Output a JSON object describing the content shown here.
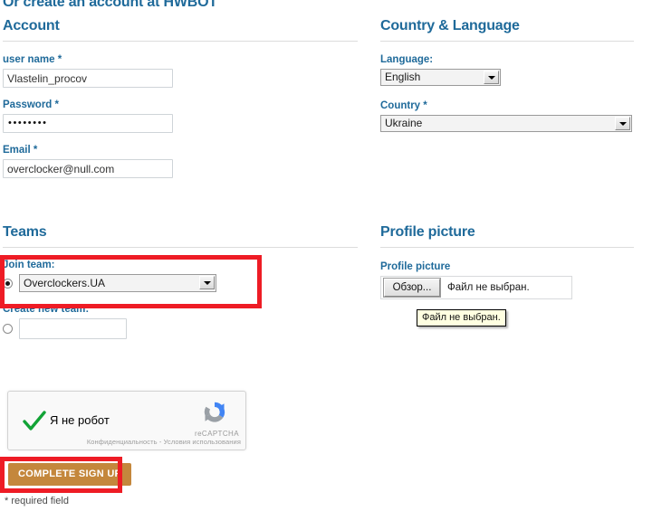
{
  "page": {
    "title": "Or create an account at HWBOT",
    "required_note": "* required field"
  },
  "account": {
    "heading": "Account",
    "username": {
      "label": "user name *",
      "value": "Vlastelin_procov"
    },
    "password": {
      "label": "Password *",
      "value": "••••••••"
    },
    "email": {
      "label": "Email *",
      "value": "overclocker@null.com"
    }
  },
  "country_language": {
    "heading": "Country & Language",
    "language": {
      "label": "Language:",
      "value": "English"
    },
    "country": {
      "label": "Country *",
      "value": "Ukraine"
    }
  },
  "teams": {
    "heading": "Teams",
    "join_team": {
      "label": "Join team:",
      "value": "Overclockers.UA"
    },
    "create_team": {
      "label": "Create new team:",
      "value": ""
    }
  },
  "profile_picture": {
    "heading": "Profile picture",
    "label": "Profile picture",
    "browse_button": "Обзор...",
    "file_status": "Файл не выбран.",
    "tooltip": "Файл не выбран."
  },
  "recaptcha": {
    "label": "Я не робот",
    "brand": "reCAPTCHA",
    "fine_print": "Конфиденциальность - Условия использования"
  },
  "submit": {
    "label": "COMPLETE SIGN UP"
  },
  "colors": {
    "heading_blue": "#1f6a9a",
    "label_blue": "#1f6a9a",
    "button_orange": "#c4873c",
    "annotation_red": "#ee1c25",
    "check_green": "#12a336"
  }
}
